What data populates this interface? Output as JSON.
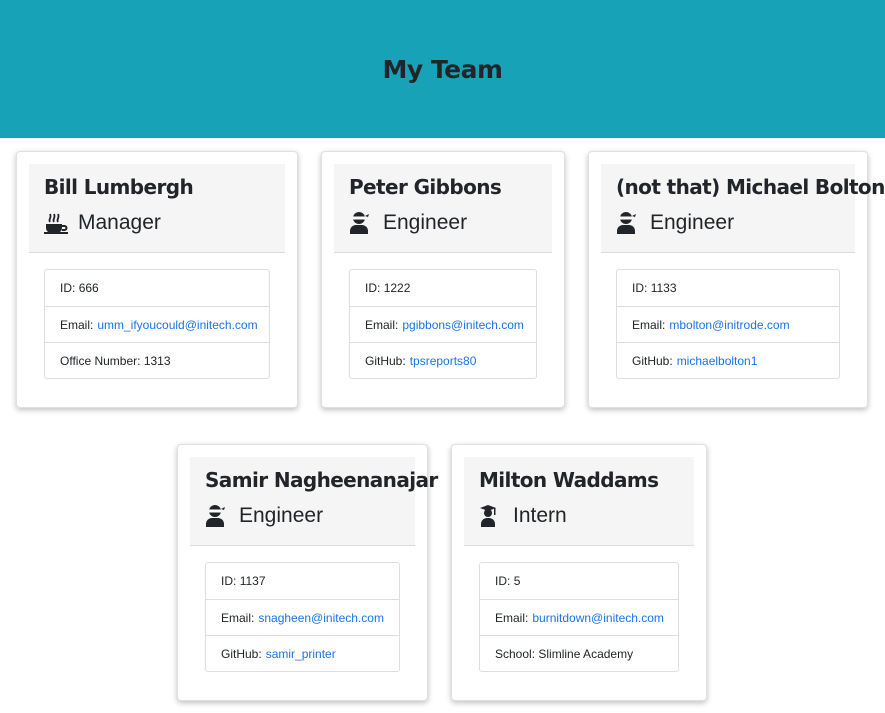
{
  "header": {
    "title": "My Team"
  },
  "cards": [
    {
      "name": "Bill Lumbergh",
      "role": "Manager",
      "role_icon": "mug-hot-icon",
      "id_label": "ID:",
      "id": "666",
      "email_label": "Email:",
      "email": "umm_ifyoucould@initech.com",
      "extra_label": "Office Number:",
      "extra": "1313"
    },
    {
      "name": "Peter Gibbons",
      "role": "Engineer",
      "role_icon": "user-ninja-icon",
      "id_label": "ID:",
      "id": "1222",
      "email_label": "Email:",
      "email": "pgibbons@initech.com",
      "extra_label": "GitHub:",
      "extra": "tpsreports80"
    },
    {
      "name": "(not that) Michael Bolton",
      "role": "Engineer",
      "role_icon": "user-ninja-icon",
      "id_label": "ID:",
      "id": "1133",
      "email_label": "Email:",
      "email": "mbolton@initrode.com",
      "extra_label": "GitHub:",
      "extra": "michaelbolton1"
    },
    {
      "name": "Samir Nagheenanajar",
      "role": "Engineer",
      "role_icon": "user-ninja-icon",
      "id_label": "ID:",
      "id": "1137",
      "email_label": "Email:",
      "email": "snagheen@initech.com",
      "extra_label": "GitHub:",
      "extra": "samir_printer"
    },
    {
      "name": "Milton Waddams",
      "role": "Intern",
      "role_icon": "user-graduate-icon",
      "id_label": "ID:",
      "id": "5",
      "email_label": "Email:",
      "email": "burnitdown@initech.com",
      "extra_label": "School:",
      "extra": "Slimline Academy"
    }
  ],
  "colors": {
    "header_bg": "#17a2b8",
    "link": "#1a73e8",
    "card_head_bg": "#f5f5f5"
  }
}
